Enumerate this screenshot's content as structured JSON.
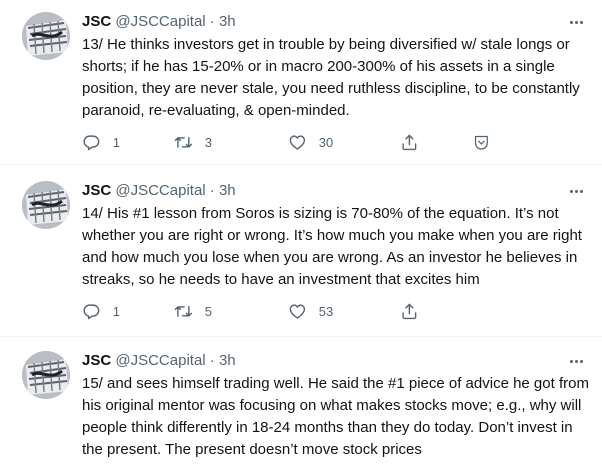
{
  "tweets": [
    {
      "name": "JSC",
      "handle": "@JSCCapital",
      "separator": "·",
      "time": "3h",
      "text": "13/ He thinks investors get in trouble by being diversified w/ stale longs or shorts; if he has 15-20% or in macro 200-300% of his assets in a single position, they are never stale, you need ruthless discipline, to be constantly paranoid, re-evaluating, & open-minded.",
      "replies": "1",
      "retweets": "3",
      "likes": "30"
    },
    {
      "name": "JSC",
      "handle": "@JSCCapital",
      "separator": "·",
      "time": "3h",
      "text": "14/ His #1 lesson from Soros is sizing is 70-80% of the equation. It’s not whether you are right or wrong. It’s how much you make when you are right and how much you lose when you are wrong. As an investor he believes in streaks, so he needs to have an investment that excites him",
      "replies": "1",
      "retweets": "5",
      "likes": "53"
    },
    {
      "name": "JSC",
      "handle": "@JSCCapital",
      "separator": "·",
      "time": "3h",
      "text": "15/ and sees himself trading well. He said the #1 piece of advice he got from his original mentor was focusing on what makes stocks move; e.g., why will people think differently in 18-24 months than they do today. Don’t invest in the present. The present doesn’t move stock prices"
    }
  ],
  "icons": {
    "reply": "reply-icon",
    "retweet": "retweet-icon",
    "like": "like-icon",
    "share": "share-icon",
    "tip": "tip-icon",
    "more": "more-icon"
  },
  "colors": {
    "text": "#0f1419",
    "secondary": "#536471",
    "divider": "#eff3f4"
  }
}
